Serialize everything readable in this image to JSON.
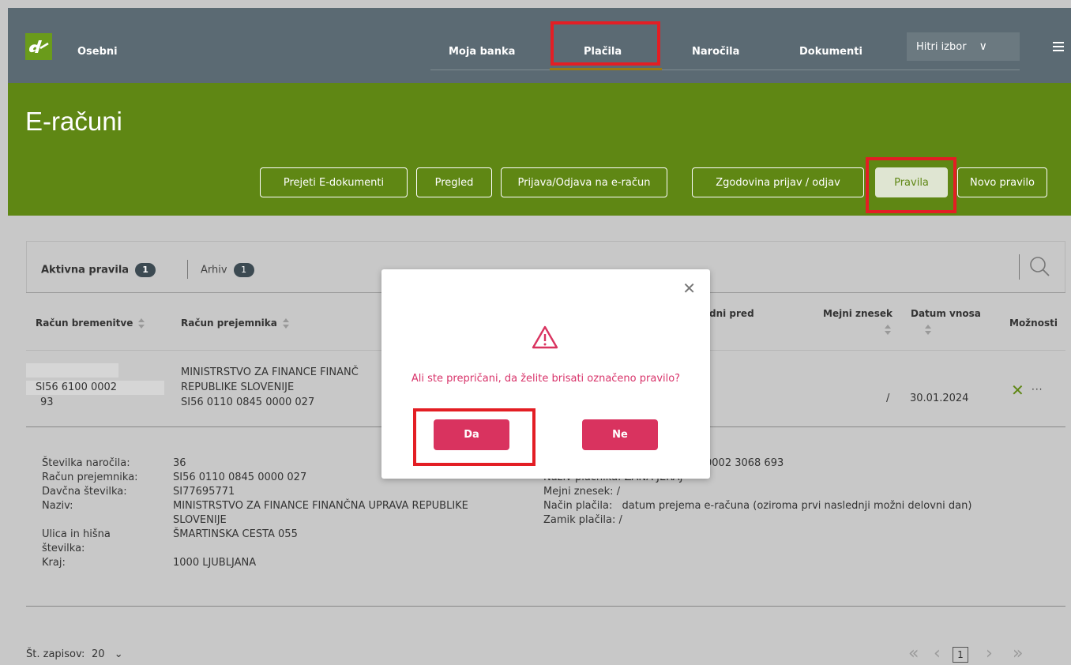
{
  "nav": {
    "brand": "Osebni",
    "items": [
      "Moja banka",
      "Plačila",
      "Naročila",
      "Dokumenti"
    ],
    "quick_select": "Hitri izbor"
  },
  "header": {
    "title": "E-računi",
    "buttons": [
      "Prejeti E-dokumenti",
      "Pregled",
      "Prijava/Odjava na e-račun",
      "Zgodovina prijav / odjav",
      "Pravila",
      "Novo pravilo"
    ]
  },
  "tabs": {
    "active_label": "Aktivna pravila",
    "active_count": "1",
    "archive_label": "Arhiv",
    "archive_count": "1"
  },
  "table": {
    "headers": {
      "debit_account": "Račun bremenitve",
      "recipient_account": "Račun prejemnika",
      "days_before": "dni pred",
      "limit": "Mejni znesek",
      "entry_date": "Datum vnosa",
      "options": "Možnosti"
    },
    "row": {
      "debit_line1": "SI56 6100 0002",
      "debit_line2": "93",
      "recipient_line1": "MINISTRSTVO ZA FINANCE FINANČ",
      "recipient_line2": "REPUBLIKE SLOVENIJE",
      "recipient_line3": "SI56 0110 0845 0000 027",
      "limit": "/",
      "entry_date": "30.01.2024"
    }
  },
  "details": {
    "labels": [
      "Številka naročila:",
      "Račun prejemnika:",
      "Davčna številka:",
      "Naziv:",
      "Ulica in hišna",
      "številka:",
      "Kraj:"
    ],
    "order_no": "36",
    "recipient_account": "SI56 0110 0845 0000 027",
    "tax_no": "SI77695771",
    "name_line1": "MINISTRSTVO ZA FINANCE FINANČNA UPRAVA REPUBLIKE",
    "name_line2": "SLOVENIJE",
    "street": "ŠMARTINSKA CESTA 055",
    "city": "1000 LJUBLJANA",
    "right_account_partial": "0002 3068 693",
    "payer_label_partial": "Naziv plačnika:",
    "payer_value_partial": "ŽANA JERAJ",
    "limit_label": "Mejni znesek:",
    "limit_value": "/",
    "payment_method_label": "Način plačila:",
    "payment_method_value": "datum prejema e-računa (oziroma prvi naslednji možni delovni dan)",
    "offset_label": "Zamik plačila:",
    "offset_value": "/"
  },
  "footer": {
    "records_label": "Št. zapisov:",
    "records_value": "20",
    "page": "1"
  },
  "modal": {
    "message": "Ali ste prepričani, da želite brisati označeno pravilo?",
    "yes": "Da",
    "no": "Ne"
  },
  "colors": {
    "nav_bg": "#5b6a73",
    "header_green": "#5f8714",
    "modal_accent": "#d9335f",
    "highlight_red": "#e31e24"
  }
}
